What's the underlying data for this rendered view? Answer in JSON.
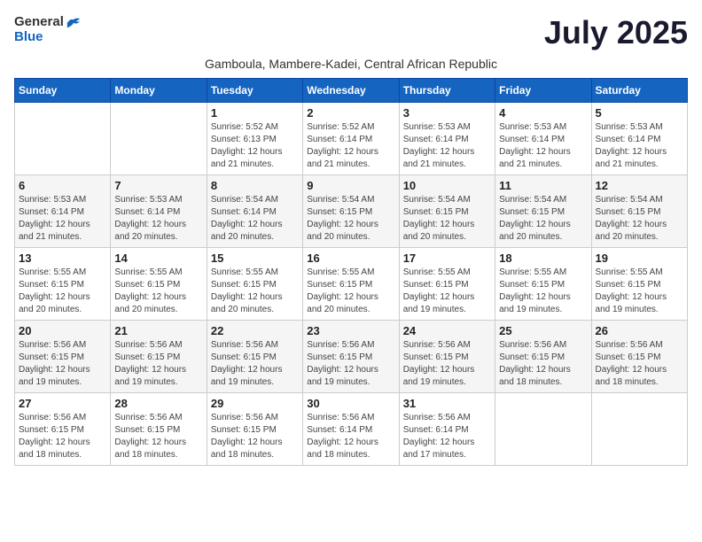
{
  "header": {
    "logo_general": "General",
    "logo_blue": "Blue",
    "month_title": "July 2025",
    "subtitle": "Gamboula, Mambere-Kadei, Central African Republic"
  },
  "days_of_week": [
    "Sunday",
    "Monday",
    "Tuesday",
    "Wednesday",
    "Thursday",
    "Friday",
    "Saturday"
  ],
  "weeks": [
    [
      {
        "day": "",
        "info": ""
      },
      {
        "day": "",
        "info": ""
      },
      {
        "day": "1",
        "info": "Sunrise: 5:52 AM\nSunset: 6:13 PM\nDaylight: 12 hours\nand 21 minutes."
      },
      {
        "day": "2",
        "info": "Sunrise: 5:52 AM\nSunset: 6:14 PM\nDaylight: 12 hours\nand 21 minutes."
      },
      {
        "day": "3",
        "info": "Sunrise: 5:53 AM\nSunset: 6:14 PM\nDaylight: 12 hours\nand 21 minutes."
      },
      {
        "day": "4",
        "info": "Sunrise: 5:53 AM\nSunset: 6:14 PM\nDaylight: 12 hours\nand 21 minutes."
      },
      {
        "day": "5",
        "info": "Sunrise: 5:53 AM\nSunset: 6:14 PM\nDaylight: 12 hours\nand 21 minutes."
      }
    ],
    [
      {
        "day": "6",
        "info": "Sunrise: 5:53 AM\nSunset: 6:14 PM\nDaylight: 12 hours\nand 21 minutes."
      },
      {
        "day": "7",
        "info": "Sunrise: 5:53 AM\nSunset: 6:14 PM\nDaylight: 12 hours\nand 20 minutes."
      },
      {
        "day": "8",
        "info": "Sunrise: 5:54 AM\nSunset: 6:14 PM\nDaylight: 12 hours\nand 20 minutes."
      },
      {
        "day": "9",
        "info": "Sunrise: 5:54 AM\nSunset: 6:15 PM\nDaylight: 12 hours\nand 20 minutes."
      },
      {
        "day": "10",
        "info": "Sunrise: 5:54 AM\nSunset: 6:15 PM\nDaylight: 12 hours\nand 20 minutes."
      },
      {
        "day": "11",
        "info": "Sunrise: 5:54 AM\nSunset: 6:15 PM\nDaylight: 12 hours\nand 20 minutes."
      },
      {
        "day": "12",
        "info": "Sunrise: 5:54 AM\nSunset: 6:15 PM\nDaylight: 12 hours\nand 20 minutes."
      }
    ],
    [
      {
        "day": "13",
        "info": "Sunrise: 5:55 AM\nSunset: 6:15 PM\nDaylight: 12 hours\nand 20 minutes."
      },
      {
        "day": "14",
        "info": "Sunrise: 5:55 AM\nSunset: 6:15 PM\nDaylight: 12 hours\nand 20 minutes."
      },
      {
        "day": "15",
        "info": "Sunrise: 5:55 AM\nSunset: 6:15 PM\nDaylight: 12 hours\nand 20 minutes."
      },
      {
        "day": "16",
        "info": "Sunrise: 5:55 AM\nSunset: 6:15 PM\nDaylight: 12 hours\nand 20 minutes."
      },
      {
        "day": "17",
        "info": "Sunrise: 5:55 AM\nSunset: 6:15 PM\nDaylight: 12 hours\nand 19 minutes."
      },
      {
        "day": "18",
        "info": "Sunrise: 5:55 AM\nSunset: 6:15 PM\nDaylight: 12 hours\nand 19 minutes."
      },
      {
        "day": "19",
        "info": "Sunrise: 5:55 AM\nSunset: 6:15 PM\nDaylight: 12 hours\nand 19 minutes."
      }
    ],
    [
      {
        "day": "20",
        "info": "Sunrise: 5:56 AM\nSunset: 6:15 PM\nDaylight: 12 hours\nand 19 minutes."
      },
      {
        "day": "21",
        "info": "Sunrise: 5:56 AM\nSunset: 6:15 PM\nDaylight: 12 hours\nand 19 minutes."
      },
      {
        "day": "22",
        "info": "Sunrise: 5:56 AM\nSunset: 6:15 PM\nDaylight: 12 hours\nand 19 minutes."
      },
      {
        "day": "23",
        "info": "Sunrise: 5:56 AM\nSunset: 6:15 PM\nDaylight: 12 hours\nand 19 minutes."
      },
      {
        "day": "24",
        "info": "Sunrise: 5:56 AM\nSunset: 6:15 PM\nDaylight: 12 hours\nand 19 minutes."
      },
      {
        "day": "25",
        "info": "Sunrise: 5:56 AM\nSunset: 6:15 PM\nDaylight: 12 hours\nand 18 minutes."
      },
      {
        "day": "26",
        "info": "Sunrise: 5:56 AM\nSunset: 6:15 PM\nDaylight: 12 hours\nand 18 minutes."
      }
    ],
    [
      {
        "day": "27",
        "info": "Sunrise: 5:56 AM\nSunset: 6:15 PM\nDaylight: 12 hours\nand 18 minutes."
      },
      {
        "day": "28",
        "info": "Sunrise: 5:56 AM\nSunset: 6:15 PM\nDaylight: 12 hours\nand 18 minutes."
      },
      {
        "day": "29",
        "info": "Sunrise: 5:56 AM\nSunset: 6:15 PM\nDaylight: 12 hours\nand 18 minutes."
      },
      {
        "day": "30",
        "info": "Sunrise: 5:56 AM\nSunset: 6:14 PM\nDaylight: 12 hours\nand 18 minutes."
      },
      {
        "day": "31",
        "info": "Sunrise: 5:56 AM\nSunset: 6:14 PM\nDaylight: 12 hours\nand 17 minutes."
      },
      {
        "day": "",
        "info": ""
      },
      {
        "day": "",
        "info": ""
      }
    ]
  ]
}
